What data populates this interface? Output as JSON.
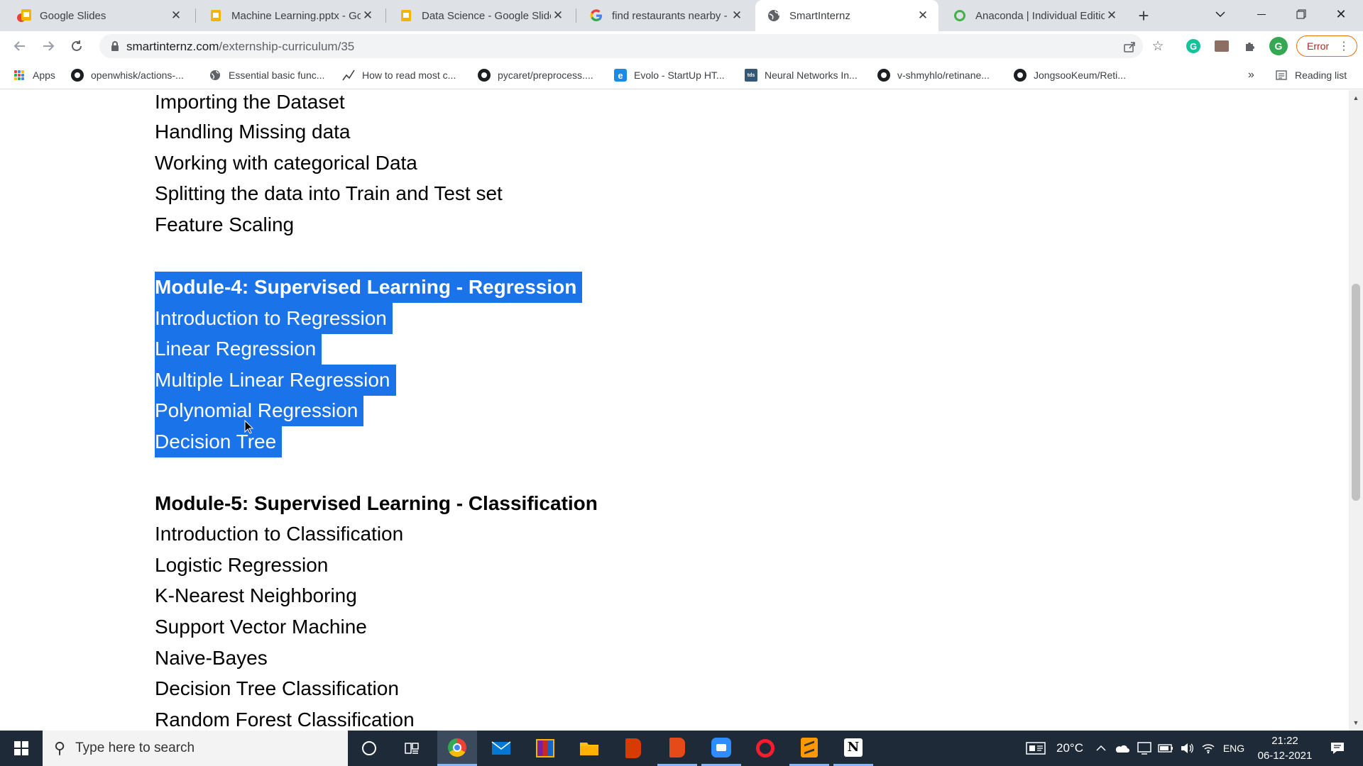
{
  "browser": {
    "tabs": [
      {
        "title": "Google Slides",
        "icon": "slides-icon"
      },
      {
        "title": "Machine Learning.pptx - Google Slides",
        "icon": "slides-icon"
      },
      {
        "title": "Data Science - Google Slides",
        "icon": "slides-icon"
      },
      {
        "title": "find restaurants nearby - Google Search",
        "icon": "google-icon"
      },
      {
        "title": "SmartInternz",
        "icon": "globe-icon",
        "active": true
      },
      {
        "title": "Anaconda | Individual Edition",
        "icon": "anaconda-icon"
      }
    ],
    "url": {
      "domain": "smartinternz.com",
      "path": "/externship-curriculum/35"
    },
    "profile_initial": "G",
    "error_label": "Error",
    "bookmarks": [
      {
        "label": "Apps",
        "icon": "apps-grid-icon"
      },
      {
        "label": "openwhisk/actions-...",
        "icon": "github-icon"
      },
      {
        "label": "Essential basic func...",
        "icon": "globe-icon"
      },
      {
        "label": "How to read most c...",
        "icon": "chart-line-icon"
      },
      {
        "label": "pycaret/preprocess....",
        "icon": "github-icon"
      },
      {
        "label": "Evolo - StartUp HT...",
        "icon": "evolo-icon"
      },
      {
        "label": "Neural Networks In...",
        "icon": "tds-icon"
      },
      {
        "label": "v-shmyhlo/retinane...",
        "icon": "github-icon"
      },
      {
        "label": "JongsooKeum/Reti...",
        "icon": "github-icon"
      }
    ],
    "bookmarks_overflow": "»",
    "reading_list": "Reading list"
  },
  "content": {
    "lines": [
      {
        "text": "Importing the Dataset",
        "heading": false,
        "selected": false
      },
      {
        "text": "Handling Missing data",
        "heading": false,
        "selected": false
      },
      {
        "text": "Working with categorical Data",
        "heading": false,
        "selected": false
      },
      {
        "text": "Splitting the data into Train and Test set",
        "heading": false,
        "selected": false
      },
      {
        "text": "Feature Scaling",
        "heading": false,
        "selected": false
      },
      {
        "text": "Module-4: Supervised Learning - Regression",
        "heading": true,
        "selected": true
      },
      {
        "text": "Introduction to Regression",
        "heading": false,
        "selected": true
      },
      {
        "text": "Linear Regression",
        "heading": false,
        "selected": true
      },
      {
        "text": "Multiple Linear Regression",
        "heading": false,
        "selected": true
      },
      {
        "text": "Polynomial Regression",
        "heading": false,
        "selected": true
      },
      {
        "text": "Decision Tree",
        "heading": false,
        "selected": true
      },
      {
        "text": "Module-5: Supervised Learning - Classification",
        "heading": true,
        "selected": false
      },
      {
        "text": "Introduction to Classification",
        "heading": false,
        "selected": false
      },
      {
        "text": "Logistic Regression",
        "heading": false,
        "selected": false
      },
      {
        "text": "K-Nearest Neighboring",
        "heading": false,
        "selected": false
      },
      {
        "text": "Support Vector Machine",
        "heading": false,
        "selected": false
      },
      {
        "text": "Naive-Bayes",
        "heading": false,
        "selected": false
      },
      {
        "text": "Decision Tree Classification",
        "heading": false,
        "selected": false
      },
      {
        "text": "Random Forest Classification",
        "heading": false,
        "selected": false
      }
    ]
  },
  "taskbar": {
    "search_placeholder": "Type here to search",
    "apps": [
      "cortana-icon",
      "task-view-icon",
      "chrome-icon",
      "mail-icon",
      "winrar-icon",
      "file-explorer-icon",
      "office-icon",
      "office-icon",
      "zoom-icon",
      "opera-icon",
      "sublime-text-icon",
      "notion-icon"
    ],
    "weather": "20°C",
    "language": "ENG",
    "time": "21:22",
    "date": "06-12-2021"
  },
  "colors": {
    "selection": "#1a73e8",
    "tabstrip": "#dee1e6",
    "taskbar": "#1f2a38"
  }
}
